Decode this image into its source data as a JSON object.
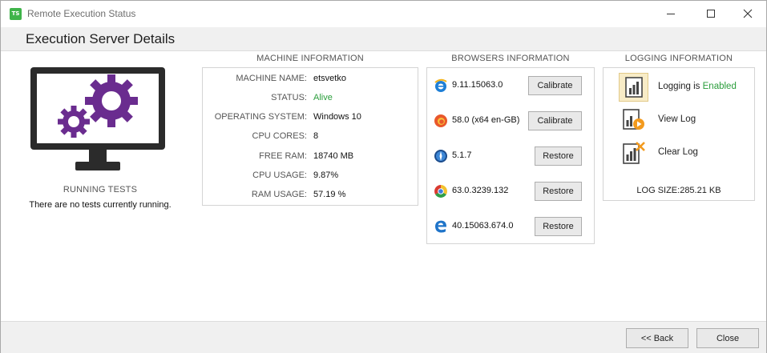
{
  "window": {
    "title": "Remote Execution Status",
    "app_icon_text": "TS",
    "app_icon_color": "#3fb44a"
  },
  "header": {
    "title": "Execution Server Details"
  },
  "running_tests": {
    "title": "RUNNING TESTS",
    "message": "There are no tests currently running."
  },
  "machine": {
    "title": "MACHINE INFORMATION",
    "rows": [
      {
        "label": "MACHINE NAME:",
        "value": "etsvetko"
      },
      {
        "label": "STATUS:",
        "value": "Alive"
      },
      {
        "label": "OPERATING SYSTEM:",
        "value": "Windows 10"
      },
      {
        "label": "CPU CORES:",
        "value": "8"
      },
      {
        "label": "FREE RAM:",
        "value": "18740 MB"
      },
      {
        "label": "CPU USAGE:",
        "value": "9.87%"
      },
      {
        "label": "RAM USAGE:",
        "value": "57.19 %"
      }
    ]
  },
  "browsers": {
    "title": "BROWSERS INFORMATION",
    "items": [
      {
        "icon": "internet-explorer-icon",
        "version": "9.11.15063.0",
        "action": "Calibrate"
      },
      {
        "icon": "firefox-icon",
        "version": "58.0 (x64 en-GB)",
        "action": "Calibrate"
      },
      {
        "icon": "safari-icon",
        "version": "5.1.7",
        "action": "Restore"
      },
      {
        "icon": "chrome-icon",
        "version": "63.0.3239.132",
        "action": "Restore"
      },
      {
        "icon": "edge-icon",
        "version": "40.15063.674.0",
        "action": "Restore"
      }
    ]
  },
  "logging": {
    "title": "LOGGING INFORMATION",
    "status_prefix": "Logging is",
    "status_value": "Enabled",
    "view_log": "View Log",
    "clear_log": "Clear Log",
    "log_size": "LOG SIZE:285.21 KB"
  },
  "footer": {
    "back_label": "<< Back",
    "close_label": "Close"
  },
  "colors": {
    "accent_purple": "#6a2c8f",
    "monitor_dark": "#2b2b2b",
    "status_green": "#2a9d3b"
  }
}
